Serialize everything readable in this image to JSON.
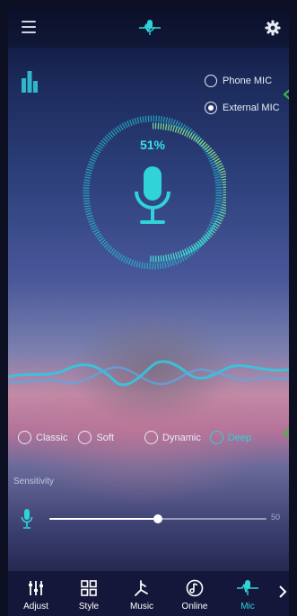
{
  "top_bar": {
    "menu_icon": "menu-icon",
    "logo_icon": "microphone-wave-icon",
    "settings_icon": "gear-icon"
  },
  "colors": {
    "accent": "#2fd3d8",
    "bottom_bar": "#15173a",
    "annotation_arrow": "#3bbd3b"
  },
  "mic_source": {
    "options": [
      {
        "label": "Phone MIC",
        "selected": false
      },
      {
        "label": "External MIC",
        "selected": true
      }
    ]
  },
  "level_meter": {
    "percent_label": "51%",
    "level": 0.51
  },
  "styles": {
    "items": [
      {
        "label": "Classic",
        "selected": false
      },
      {
        "label": "Soft",
        "selected": false
      },
      {
        "label": "Dynamic",
        "selected": false
      },
      {
        "label": "Deep",
        "selected": true
      }
    ]
  },
  "sensitivity": {
    "label": "Sensitivity",
    "value_label": "50",
    "value": 0.5
  },
  "bottom_nav": {
    "tabs": [
      {
        "label": "Adjust",
        "icon": "equalizer-sliders-icon",
        "active": false
      },
      {
        "label": "Style",
        "icon": "grid-icon",
        "active": false
      },
      {
        "label": "Music",
        "icon": "music-note-icon",
        "active": false
      },
      {
        "label": "Online",
        "icon": "online-music-icon",
        "active": false
      },
      {
        "label": "Mic",
        "icon": "microphone-wave-icon",
        "active": true
      }
    ],
    "more_icon": "chevron-right-icon"
  }
}
